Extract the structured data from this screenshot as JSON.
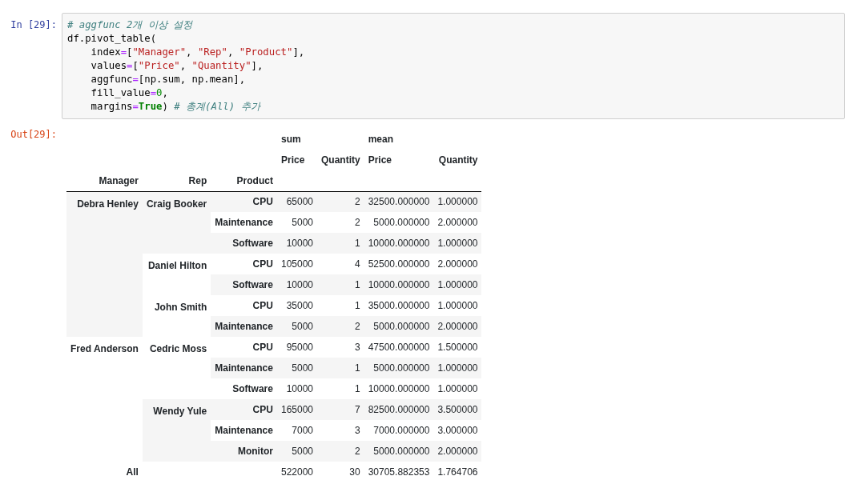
{
  "input_prompt": "In [29]:",
  "code": [
    [
      {
        "kind": "comment",
        "text": "# aggfunc 2개 이상 설정"
      }
    ],
    [
      {
        "kind": "plain",
        "text": "df.pivot_table("
      }
    ],
    [
      {
        "kind": "plain",
        "text": "    index"
      },
      {
        "kind": "operator",
        "text": "="
      },
      {
        "kind": "plain",
        "text": "["
      },
      {
        "kind": "string",
        "text": "\"Manager\""
      },
      {
        "kind": "plain",
        "text": ", "
      },
      {
        "kind": "string",
        "text": "\"Rep\""
      },
      {
        "kind": "plain",
        "text": ", "
      },
      {
        "kind": "string",
        "text": "\"Product\""
      },
      {
        "kind": "plain",
        "text": "],"
      }
    ],
    [
      {
        "kind": "plain",
        "text": "    values"
      },
      {
        "kind": "operator",
        "text": "="
      },
      {
        "kind": "plain",
        "text": "["
      },
      {
        "kind": "string",
        "text": "\"Price\""
      },
      {
        "kind": "plain",
        "text": ", "
      },
      {
        "kind": "string",
        "text": "\"Quantity\""
      },
      {
        "kind": "plain",
        "text": "],"
      }
    ],
    [
      {
        "kind": "plain",
        "text": "    aggfunc"
      },
      {
        "kind": "operator",
        "text": "="
      },
      {
        "kind": "plain",
        "text": "[np.sum, np.mean],"
      }
    ],
    [
      {
        "kind": "plain",
        "text": "    fill_value"
      },
      {
        "kind": "operator",
        "text": "="
      },
      {
        "kind": "number",
        "text": "0"
      },
      {
        "kind": "plain",
        "text": ","
      }
    ],
    [
      {
        "kind": "plain",
        "text": "    margins"
      },
      {
        "kind": "operator",
        "text": "="
      },
      {
        "kind": "keyword",
        "text": "True"
      },
      {
        "kind": "plain",
        "text": ") "
      },
      {
        "kind": "comment",
        "text": "# 총계(All) 추가"
      }
    ]
  ],
  "output_prompt": "Out[29]:",
  "table": {
    "column_groups": [
      {
        "label": "sum",
        "columns": [
          "Price",
          "Quantity"
        ]
      },
      {
        "label": "mean",
        "columns": [
          "Price",
          "Quantity"
        ]
      }
    ],
    "index_names": [
      "Manager",
      "Rep",
      "Product"
    ],
    "managers": [
      {
        "name": "Debra Henley",
        "reps": [
          {
            "name": "Craig Booker",
            "products": [
              {
                "name": "CPU",
                "values": [
                  "65000",
                  "2",
                  "32500.000000",
                  "1.000000"
                ]
              },
              {
                "name": "Maintenance",
                "values": [
                  "5000",
                  "2",
                  "5000.000000",
                  "2.000000"
                ]
              },
              {
                "name": "Software",
                "values": [
                  "10000",
                  "1",
                  "10000.000000",
                  "1.000000"
                ]
              }
            ]
          },
          {
            "name": "Daniel Hilton",
            "products": [
              {
                "name": "CPU",
                "values": [
                  "105000",
                  "4",
                  "52500.000000",
                  "2.000000"
                ]
              },
              {
                "name": "Software",
                "values": [
                  "10000",
                  "1",
                  "10000.000000",
                  "1.000000"
                ]
              }
            ]
          },
          {
            "name": "John Smith",
            "products": [
              {
                "name": "CPU",
                "values": [
                  "35000",
                  "1",
                  "35000.000000",
                  "1.000000"
                ]
              },
              {
                "name": "Maintenance",
                "values": [
                  "5000",
                  "2",
                  "5000.000000",
                  "2.000000"
                ]
              }
            ]
          }
        ]
      },
      {
        "name": "Fred Anderson",
        "reps": [
          {
            "name": "Cedric Moss",
            "products": [
              {
                "name": "CPU",
                "values": [
                  "95000",
                  "3",
                  "47500.000000",
                  "1.500000"
                ]
              },
              {
                "name": "Maintenance",
                "values": [
                  "5000",
                  "1",
                  "5000.000000",
                  "1.000000"
                ]
              },
              {
                "name": "Software",
                "values": [
                  "10000",
                  "1",
                  "10000.000000",
                  "1.000000"
                ]
              }
            ]
          },
          {
            "name": "Wendy Yule",
            "products": [
              {
                "name": "CPU",
                "values": [
                  "165000",
                  "7",
                  "82500.000000",
                  "3.500000"
                ]
              },
              {
                "name": "Maintenance",
                "values": [
                  "7000",
                  "3",
                  "7000.000000",
                  "3.000000"
                ]
              },
              {
                "name": "Monitor",
                "values": [
                  "5000",
                  "2",
                  "5000.000000",
                  "2.000000"
                ]
              }
            ]
          }
        ]
      }
    ],
    "total": {
      "label": "All",
      "values": [
        "522000",
        "30",
        "30705.882353",
        "1.764706"
      ]
    }
  }
}
